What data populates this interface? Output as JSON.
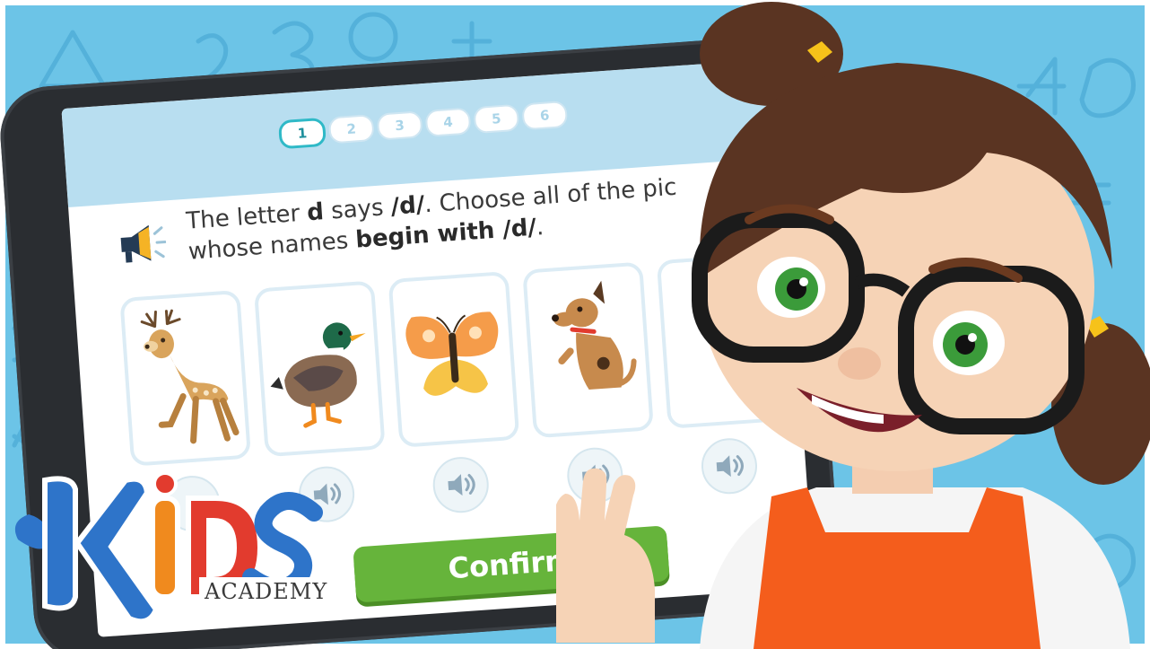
{
  "progress": {
    "steps": [
      "1",
      "2",
      "3",
      "4",
      "5",
      "6"
    ],
    "active_step": "1"
  },
  "question": {
    "part1": "The letter ",
    "letter": "d",
    "part2": " says ",
    "sound": "/d/",
    "part3": ". Choose all of the pic",
    "part4": "whose names ",
    "emphasis": "begin with /d/",
    "part5": "."
  },
  "cards": [
    {
      "animal": "deer"
    },
    {
      "animal": "duck"
    },
    {
      "animal": "butterfly"
    },
    {
      "animal": "dog"
    },
    {
      "animal": "partial-card"
    }
  ],
  "buttons": {
    "confirm_label": "Confirm"
  },
  "logo": {
    "letters": [
      "K",
      "I",
      "D",
      "S"
    ],
    "academy": "ACADEMY"
  },
  "colors": {
    "background": "#6cc4e7",
    "tablet_frame": "#2a2d31",
    "confirm_green": "#66b43b",
    "progress_active": "#2fb9c7",
    "logo_blue": "#2e74c9",
    "logo_orange": "#f08a1e",
    "logo_red": "#e23b2e",
    "apron_orange": "#f45d1c"
  },
  "icons": [
    "speaker-icon",
    "sound-icon"
  ]
}
